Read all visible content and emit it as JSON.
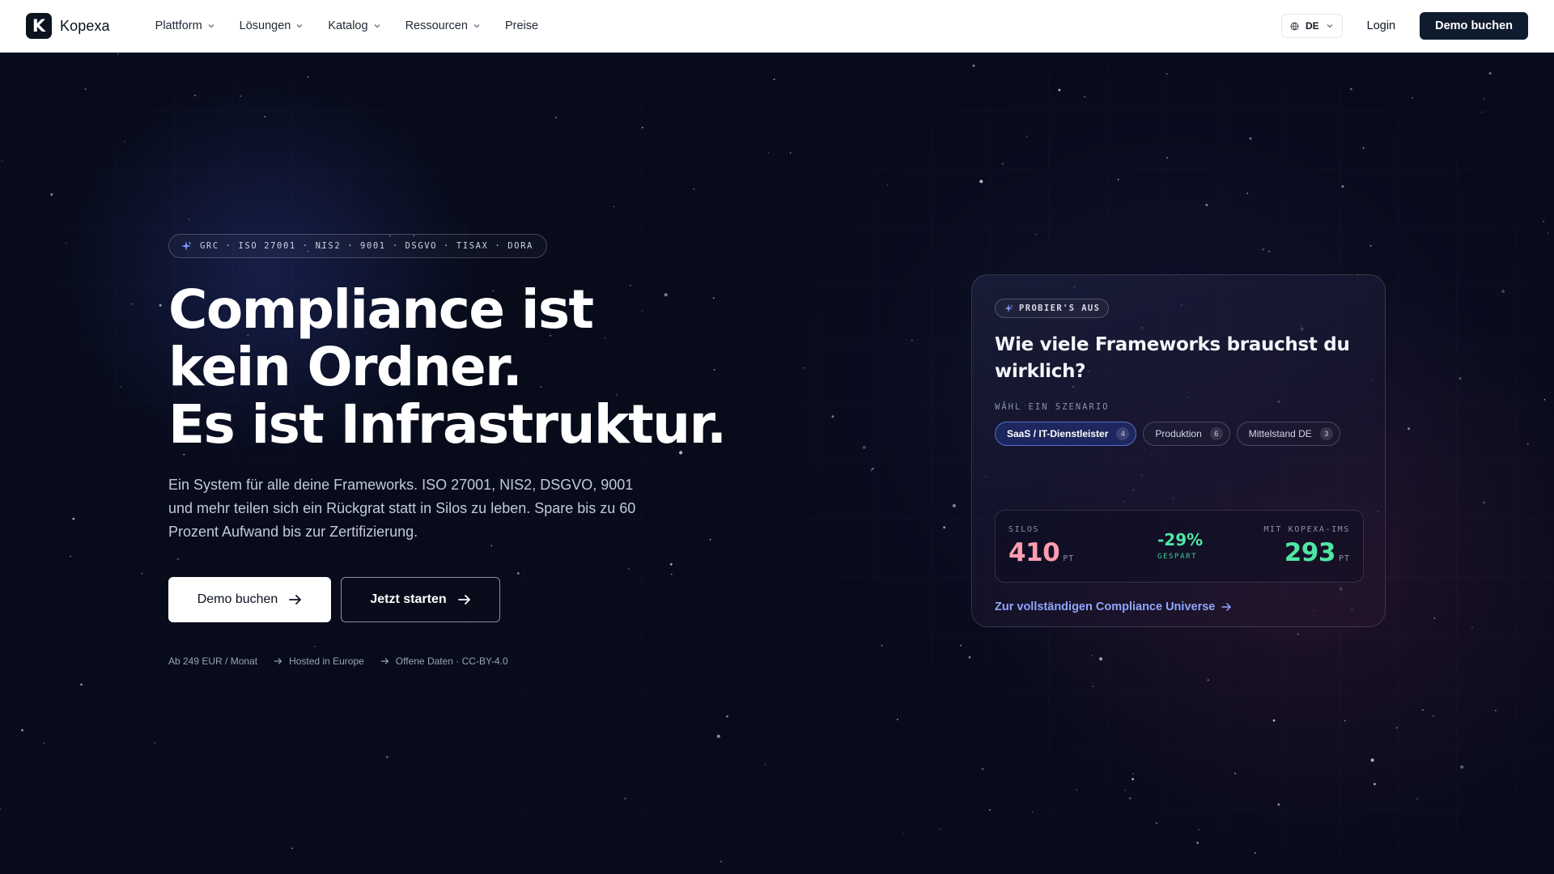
{
  "nav": {
    "logo_letter": "K",
    "brand": "Kopexa",
    "menu": [
      {
        "label": "Plattform",
        "has_dropdown": true
      },
      {
        "label": "Lösungen",
        "has_dropdown": true
      },
      {
        "label": "Katalog",
        "has_dropdown": true
      },
      {
        "label": "Ressourcen",
        "has_dropdown": true
      },
      {
        "label": "Preise",
        "has_dropdown": false
      }
    ],
    "language": "DE",
    "login": "Login",
    "cta": "Demo buchen"
  },
  "hero": {
    "badge": "GRC · ISO 27001 · NIS2 · 9001 · DSGVO · TISAX · DORA",
    "headline": [
      "Compliance ist",
      "kein Ordner.",
      "Es ist Infrastruktur."
    ],
    "lead": "Ein System für alle deine Frameworks. ISO 27001, NIS2, DSGVO, 9001 und mehr teilen sich ein Rückgrat statt in Silos zu leben. Spare bis zu 60 Prozent Aufwand bis zur Zertifizierung.",
    "primary_cta": "Demo buchen",
    "secondary_cta": "Jetzt starten",
    "meta": [
      "Ab 249 EUR / Monat",
      "Hosted in Europe",
      "Offene Daten · CC-BY-4.0"
    ]
  },
  "card": {
    "badge": "PROBIER'S AUS",
    "title": "Wie viele Frameworks brauchst du wirklich?",
    "scenario_label": "WÄHL EIN SZENARIO",
    "scenarios": [
      {
        "label": "SaaS / IT-Dienstleister",
        "count": "4",
        "active": true
      },
      {
        "label": "Produktion",
        "count": "6",
        "active": false
      },
      {
        "label": "Mittelstand DE",
        "count": "3",
        "active": false
      }
    ],
    "stats": {
      "silos_label": "SILOS",
      "silos_value": "410",
      "silos_unit": "PT",
      "saved_value": "-29%",
      "saved_label": "GESPART",
      "ims_label": "MIT KOPEXA-IMS",
      "ims_value": "293",
      "ims_unit": "PT"
    },
    "link": "Zur vollständigen Compliance Universe"
  },
  "colors": {
    "background": "#070b1a",
    "silos_value": "#ff9db0",
    "ims_value": "#4ee6a4",
    "link": "#8fa7ff",
    "nav_cta": "#0f1b2e"
  },
  "icons": {
    "badge_icon": "sparkle-icon",
    "language_icon": "globe-icon",
    "cta_arrow": "arrow-right-icon",
    "meta_arrow": "arrow-right-icon"
  }
}
